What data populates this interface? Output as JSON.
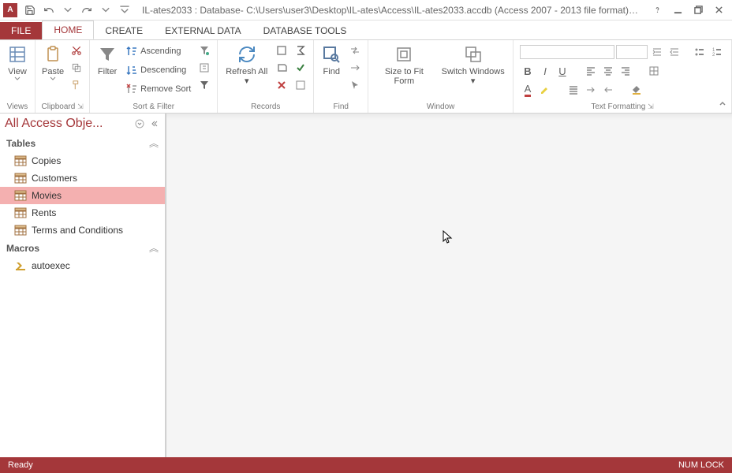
{
  "titlebar": {
    "title": "IL-ates2033 : Database- C:\\Users\\user3\\Desktop\\IL-ates\\Access\\IL-ates2033.accdb (Access 2007 - 2013 file format) - Mi..."
  },
  "tabs": {
    "file": "FILE",
    "home": "HOME",
    "create": "CREATE",
    "external": "EXTERNAL DATA",
    "dbtools": "DATABASE TOOLS"
  },
  "ribbon": {
    "views": {
      "view": "View",
      "group": "Views"
    },
    "clipboard": {
      "paste": "Paste",
      "group": "Clipboard"
    },
    "sortfilter": {
      "filter": "Filter",
      "asc": "Ascending",
      "desc": "Descending",
      "remove": "Remove Sort",
      "group": "Sort & Filter"
    },
    "records": {
      "refresh": "Refresh All",
      "group": "Records"
    },
    "find": {
      "find": "Find",
      "group": "Find"
    },
    "window": {
      "size": "Size to Fit Form",
      "switch": "Switch Windows",
      "group": "Window"
    },
    "textfmt": {
      "group": "Text Formatting"
    }
  },
  "nav": {
    "title": "All Access Obje...",
    "sections": {
      "tables": "Tables",
      "macros": "Macros"
    },
    "tables": [
      "Copies",
      "Customers",
      "Movies",
      "Rents",
      "Terms and Conditions"
    ],
    "selected": "Movies",
    "macros": [
      "autoexec"
    ]
  },
  "status": {
    "ready": "Ready",
    "numlock": "NUM LOCK"
  }
}
